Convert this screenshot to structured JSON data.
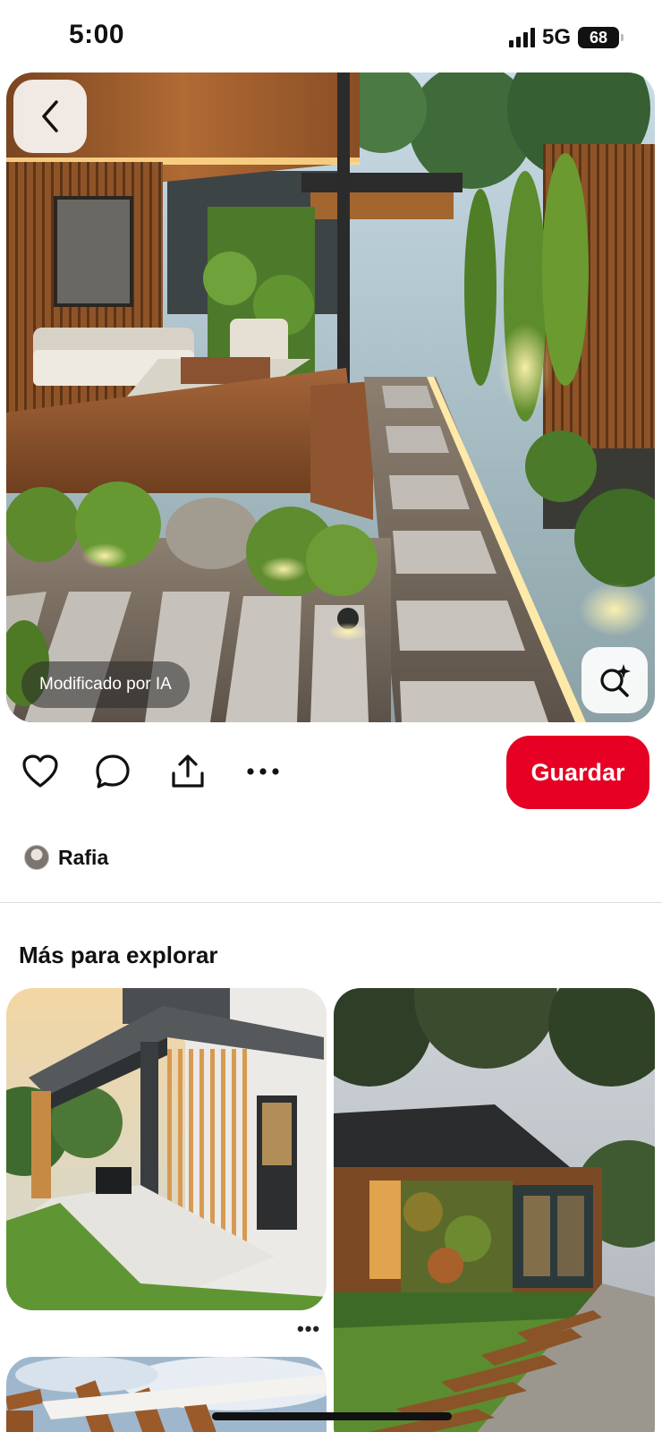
{
  "status_bar": {
    "time": "5:00",
    "network": "5G",
    "battery": "68"
  },
  "hero": {
    "ai_badge": "Modificado por IA",
    "back_icon": "chevron-left-icon",
    "lens_icon": "visual-search-icon"
  },
  "actions": {
    "like_icon": "heart-icon",
    "comment_icon": "comment-icon",
    "share_icon": "share-icon",
    "more_icon": "more-icon",
    "save_label": "Guardar"
  },
  "author": {
    "name": "Rafia"
  },
  "explore": {
    "title": "Más para explorar"
  },
  "colors": {
    "accent": "#e60023"
  }
}
